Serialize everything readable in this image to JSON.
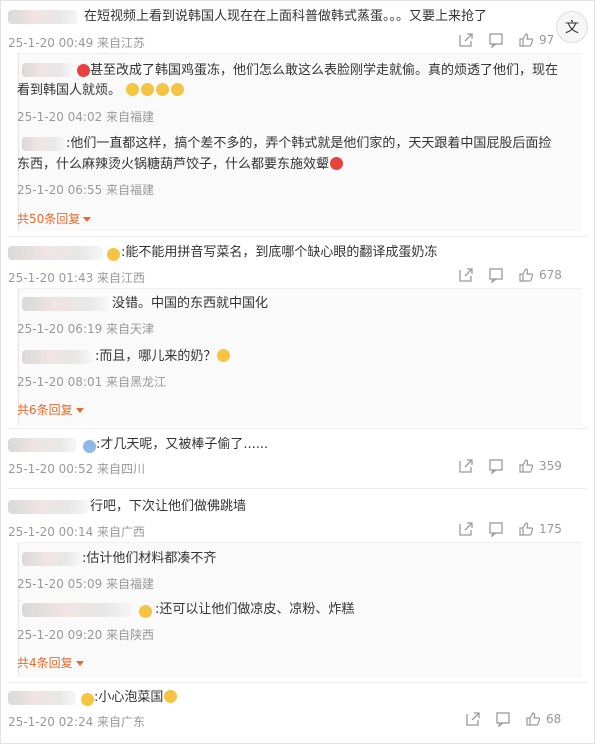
{
  "comments": [
    {
      "id": "c1",
      "text": "在短视频上看到说韩国人现在在上面科普做韩式蒸蛋。。。又要上来抢了",
      "meta": "25-1-20 00:49 来自江苏",
      "likes": "97"
    },
    {
      "id": "r1",
      "text": "甚至改成了韩国鸡蛋冻，他们怎么敢这么表脸刚学走就偷。真的烦透了他们，现在",
      "text2": "看到韩国人就烦。",
      "meta": "25-1-20 04:02 来自福建"
    },
    {
      "id": "r2",
      "text": ":他们一直都这样，搞个差不多的，弄个韩式就是他们家的，天天跟着中国屁股后面捡",
      "text2": "东西，什么麻辣烫火锅糖葫芦饺子，什么都要东施效颦",
      "meta": "25-1-20 06:55 来自福建"
    },
    {
      "id": "c2",
      "text": ":能不能用拼音写菜名，到底哪个缺心眼的翻译成蛋奶冻",
      "meta": "25-1-20 01:43 来自江西",
      "likes": "678"
    },
    {
      "id": "r3",
      "text": "没错。中国的东西就中国化",
      "meta": "25-1-20 06:19 来自天津"
    },
    {
      "id": "r4",
      "text": ":而且，哪儿来的奶？",
      "meta": "25-1-20 08:01 来自黑龙江"
    },
    {
      "id": "c3",
      "text": ":才几天呢，又被棒子偷了......",
      "meta": "25-1-20 00:52 来自四川",
      "likes": "359"
    },
    {
      "id": "c4",
      "text": "行吧，下次让他们做佛跳墙",
      "meta": "25-1-20 00:14 来自广西",
      "likes": "175"
    },
    {
      "id": "r5",
      "text": ":估计他们材料都凑不齐",
      "meta": "25-1-20 05:09 来自福建"
    },
    {
      "id": "r6",
      "text": ":还可以让他们做凉皮、凉粉、炸糕",
      "meta": "25-1-20 09:20 来自陕西"
    },
    {
      "id": "c5",
      "text": ":小心泡菜国",
      "meta": "25-1-20 02:24 来自广东",
      "likes": "68"
    }
  ],
  "more_replies": {
    "m1": "共50条回复",
    "m2": "共6条回复",
    "m3": "共4条回复"
  },
  "badge": "文"
}
